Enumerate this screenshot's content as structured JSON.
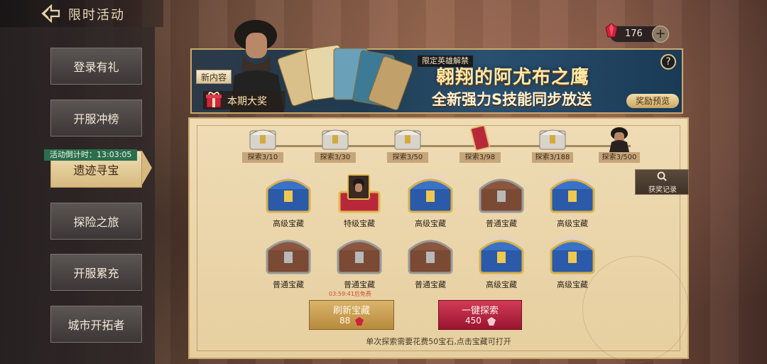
{
  "header": {
    "title": "限时活动"
  },
  "sidebar": {
    "items": [
      {
        "label": "登录有礼"
      },
      {
        "label": "开服冲榜"
      },
      {
        "label": "遗迹寻宝"
      },
      {
        "label": "探险之旅"
      },
      {
        "label": "开服累充"
      },
      {
        "label": "城市开拓者"
      }
    ],
    "countdown": "活动倒计时：13:03:05"
  },
  "currency": {
    "gems": "176"
  },
  "banner": {
    "tag": "限定英雄解禁",
    "title": "翱翔的阿尤布之鹰",
    "subtitle": "全新强力S技能同步放送",
    "preview_button": "奖励预览",
    "new_tag": "新内容",
    "grand_prize": "本期大奖",
    "help": "?"
  },
  "milestones": [
    {
      "label": "探索3/10"
    },
    {
      "label": "探索3/30"
    },
    {
      "label": "探索3/50"
    },
    {
      "label": "探索3/98"
    },
    {
      "label": "探索3/188"
    },
    {
      "label": "探索3/500"
    }
  ],
  "history_button": "获奖记录",
  "chests": [
    {
      "label": "高级宝藏",
      "kind": "blue"
    },
    {
      "label": "特级宝藏",
      "kind": "red"
    },
    {
      "label": "高级宝藏",
      "kind": "blue"
    },
    {
      "label": "普通宝藏",
      "kind": "gray"
    },
    {
      "label": "高级宝藏",
      "kind": "blue"
    },
    {
      "label": "普通宝藏",
      "kind": "gray"
    },
    {
      "label": "普通宝藏",
      "kind": "gray"
    },
    {
      "label": "普通宝藏",
      "kind": "gray"
    },
    {
      "label": "高级宝藏",
      "kind": "blue"
    },
    {
      "label": "高级宝藏",
      "kind": "blue"
    }
  ],
  "refresh": {
    "timer": "03:59:41后免费",
    "label": "刷新宝藏",
    "cost": "88"
  },
  "explore_all": {
    "label": "一键探索",
    "cost": "450"
  },
  "hint": "单次探索需要花费50宝石,点击宝藏可打开",
  "colors": {
    "accent_gold": "#caa96a",
    "explore_red": "#c0233f",
    "active_tab": "#e4c98f"
  }
}
